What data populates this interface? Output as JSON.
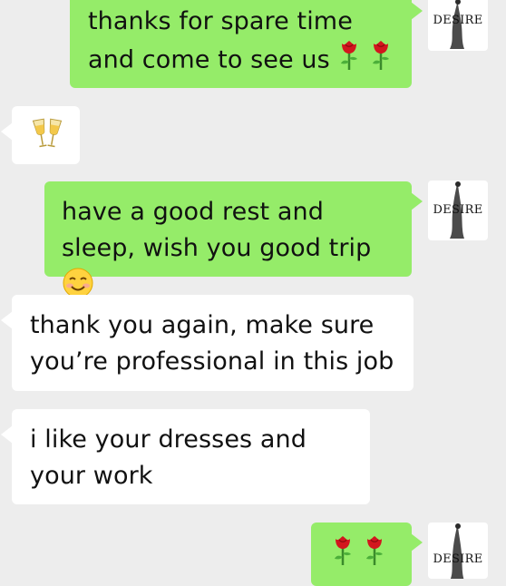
{
  "colors": {
    "background": "#ededed",
    "outgoing_bubble": "#95ec69",
    "incoming_bubble": "#ffffff"
  },
  "avatar": {
    "icon": "desire-logo-icon",
    "label": "DESIRE"
  },
  "messages": [
    {
      "direction": "outgoing",
      "text": "thanks for spare time and come to see us",
      "emoji": [
        "rose",
        "rose"
      ]
    },
    {
      "direction": "incoming",
      "text": "",
      "emoji": [
        "clinking-glasses"
      ]
    },
    {
      "direction": "outgoing",
      "text": "have a good rest and sleep, wish you good trip",
      "emoji": [
        "smiling-face"
      ]
    },
    {
      "direction": "incoming",
      "text": "thank you again, make sure you’re professional in this job",
      "emoji": []
    },
    {
      "direction": "incoming",
      "text": "i like your dresses and your work",
      "emoji": []
    },
    {
      "direction": "outgoing",
      "text": "",
      "emoji": [
        "rose",
        "rose"
      ]
    }
  ]
}
